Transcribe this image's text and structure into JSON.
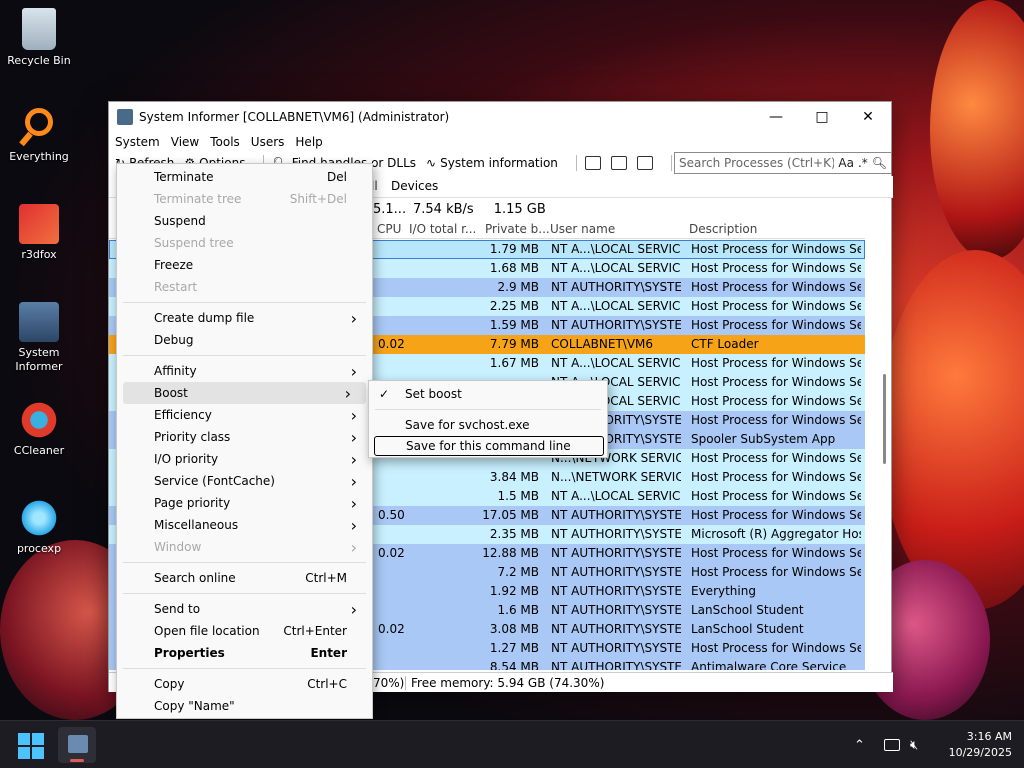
{
  "desktop": {
    "icons": [
      {
        "label": "Recycle Bin"
      },
      {
        "label": "Everything"
      },
      {
        "label": "r3dfox"
      },
      {
        "label": "System Informer"
      },
      {
        "label": "CCleaner"
      },
      {
        "label": "procexp"
      }
    ]
  },
  "window": {
    "title": "System Informer [COLLABNET\\VM6] (Administrator)",
    "menu": [
      "System",
      "View",
      "Tools",
      "Users",
      "Help"
    ],
    "toolbar": {
      "refresh": "Refresh",
      "options": "Options",
      "find_handles": "Find handles or DLLs",
      "system_information": "System information"
    },
    "search_placeholder": "Search Processes (Ctrl+K)",
    "search_opts": "Aa",
    "tab_fragment": "ll",
    "tab_devices": "Devices",
    "stats": {
      "cpu": "5.1...",
      "io": "7.54 kB/s",
      "private": "1.15 GB"
    },
    "columns": {
      "cpu": "CPU",
      "io": "I/O total r...",
      "private": "Private b...",
      "user": "User name",
      "desc": "Description"
    },
    "status": {
      "left": "70%)",
      "free_memory": "Free memory: 5.94 GB (74.30%)"
    }
  },
  "rows": [
    {
      "cpu": "",
      "priv": "1.79 MB",
      "user": "NT A...\\LOCAL SERVICE",
      "desc": "Host Process for Windows Ser...",
      "bg": "#b8e6fb",
      "selected": true
    },
    {
      "cpu": "",
      "priv": "1.68 MB",
      "user": "NT A...\\LOCAL SERVICE",
      "desc": "Host Process for Windows Ser...",
      "bg": "#c8f0ff"
    },
    {
      "cpu": "",
      "priv": "2.9 MB",
      "user": "NT AUTHORITY\\SYSTEM",
      "desc": "Host Process for Windows Ser...",
      "bg": "#a9c8f5"
    },
    {
      "cpu": "",
      "priv": "2.25 MB",
      "user": "NT A...\\LOCAL SERVICE",
      "desc": "Host Process for Windows Ser...",
      "bg": "#c8f0ff"
    },
    {
      "cpu": "",
      "priv": "1.59 MB",
      "user": "NT AUTHORITY\\SYSTEM",
      "desc": "Host Process for Windows Ser...",
      "bg": "#a9c8f5"
    },
    {
      "cpu": "0.02",
      "priv": "7.79 MB",
      "user": "COLLABNET\\VM6",
      "desc": "CTF Loader",
      "bg": "#f6a318"
    },
    {
      "cpu": "",
      "priv": "1.67 MB",
      "user": "NT A...\\LOCAL SERVICE",
      "desc": "Host Process for Windows Ser...",
      "bg": "#c8f0ff"
    },
    {
      "cpu": "",
      "priv": "",
      "user": "NT A...\\LOCAL SERVICE",
      "desc": "Host Process for Windows Ser...",
      "bg": "#c8f0ff"
    },
    {
      "cpu": "",
      "priv": "",
      "user": "NT A...\\LOCAL SERVICE",
      "desc": "Host Process for Windows Ser...",
      "bg": "#c8f0ff"
    },
    {
      "cpu": "",
      "priv": "",
      "user": "NT AUTHORITY\\SYSTEM",
      "desc": "Host Process for Windows Ser...",
      "bg": "#a9c8f5"
    },
    {
      "cpu": "",
      "priv": "",
      "user": "NT AUTHORITY\\SYSTEM",
      "desc": "Spooler SubSystem App",
      "bg": "#a9c8f5"
    },
    {
      "cpu": "",
      "priv": "",
      "user": "N...\\NETWORK SERVICE",
      "desc": "Host Process for Windows Ser...",
      "bg": "#c8f0ff"
    },
    {
      "cpu": "",
      "priv": "3.84 MB",
      "user": "N...\\NETWORK SERVICE",
      "desc": "Host Process for Windows Ser...",
      "bg": "#c8f0ff"
    },
    {
      "cpu": "",
      "priv": "1.5 MB",
      "user": "NT A...\\LOCAL SERVICE",
      "desc": "Host Process for Windows Ser...",
      "bg": "#c8f0ff"
    },
    {
      "cpu": "0.50",
      "priv": "17.05 MB",
      "user": "NT AUTHORITY\\SYSTEM",
      "desc": "Host Process for Windows Ser...",
      "bg": "#a9c8f5"
    },
    {
      "cpu": "",
      "priv": "2.35 MB",
      "user": "NT AUTHORITY\\SYSTEM",
      "desc": "Microsoft (R) Aggregator Host",
      "bg": "#c8f0ff"
    },
    {
      "cpu": "0.02",
      "priv": "12.88 MB",
      "user": "NT AUTHORITY\\SYSTEM",
      "desc": "Host Process for Windows Ser...",
      "bg": "#a9c8f5"
    },
    {
      "cpu": "",
      "priv": "7.2 MB",
      "user": "NT AUTHORITY\\SYSTEM",
      "desc": "Host Process for Windows Ser...",
      "bg": "#a9c8f5"
    },
    {
      "cpu": "",
      "priv": "1.92 MB",
      "user": "NT AUTHORITY\\SYSTEM",
      "desc": "Everything",
      "bg": "#a9c8f5"
    },
    {
      "cpu": "",
      "priv": "1.6 MB",
      "user": "NT AUTHORITY\\SYSTEM",
      "desc": "LanSchool Student",
      "bg": "#a9c8f5"
    },
    {
      "cpu": "0.02",
      "priv": "3.08 MB",
      "user": "NT AUTHORITY\\SYSTEM",
      "desc": "LanSchool Student",
      "bg": "#a9c8f5"
    },
    {
      "cpu": "",
      "priv": "1.27 MB",
      "user": "NT AUTHORITY\\SYSTEM",
      "desc": "Host Process for Windows Ser...",
      "bg": "#a9c8f5"
    },
    {
      "cpu": "",
      "priv": "8.54 MB",
      "user": "NT AUTHORITY\\SYSTEM",
      "desc": "Antimalware Core Service",
      "bg": "#a9c8f5"
    }
  ],
  "context_menu": {
    "items": [
      {
        "label": "Terminate",
        "shortcut": "Del",
        "type": "item"
      },
      {
        "label": "Terminate tree",
        "shortcut": "Shift+Del",
        "type": "item",
        "disabled": true
      },
      {
        "label": "Suspend",
        "type": "item"
      },
      {
        "label": "Suspend tree",
        "type": "item",
        "disabled": true
      },
      {
        "label": "Freeze",
        "type": "item"
      },
      {
        "label": "Restart",
        "type": "item",
        "disabled": true
      },
      {
        "type": "sep"
      },
      {
        "label": "Create dump file",
        "type": "item",
        "submenu": true
      },
      {
        "label": "Debug",
        "type": "item"
      },
      {
        "type": "sep"
      },
      {
        "label": "Affinity",
        "type": "item",
        "submenu": true
      },
      {
        "label": "Boost",
        "type": "item",
        "submenu": true,
        "hover": true
      },
      {
        "label": "Efficiency",
        "type": "item",
        "submenu": true
      },
      {
        "label": "Priority class",
        "type": "item",
        "submenu": true
      },
      {
        "label": "I/O priority",
        "type": "item",
        "submenu": true
      },
      {
        "label": "Service (FontCache)",
        "type": "item",
        "submenu": true
      },
      {
        "label": "Page priority",
        "type": "item",
        "submenu": true
      },
      {
        "label": "Miscellaneous",
        "type": "item",
        "submenu": true
      },
      {
        "label": "Window",
        "type": "item",
        "submenu": true,
        "disabled": true
      },
      {
        "type": "sep"
      },
      {
        "label": "Search online",
        "shortcut": "Ctrl+M",
        "type": "item"
      },
      {
        "type": "sep"
      },
      {
        "label": "Send to",
        "type": "item",
        "submenu": true
      },
      {
        "label": "Open file location",
        "shortcut": "Ctrl+Enter",
        "type": "item"
      },
      {
        "label": "Properties",
        "shortcut": "Enter",
        "type": "item",
        "bold": true
      },
      {
        "type": "sep"
      },
      {
        "label": "Copy",
        "shortcut": "Ctrl+C",
        "type": "item"
      },
      {
        "label": "Copy \"Name\"",
        "type": "item"
      }
    ]
  },
  "boost_submenu": {
    "set_boost": "Set boost",
    "save_svchost": "Save for svchost.exe",
    "save_cmdline": "Save for this command line"
  },
  "taskbar": {
    "time": "3:16 AM",
    "date": "10/29/2025"
  }
}
